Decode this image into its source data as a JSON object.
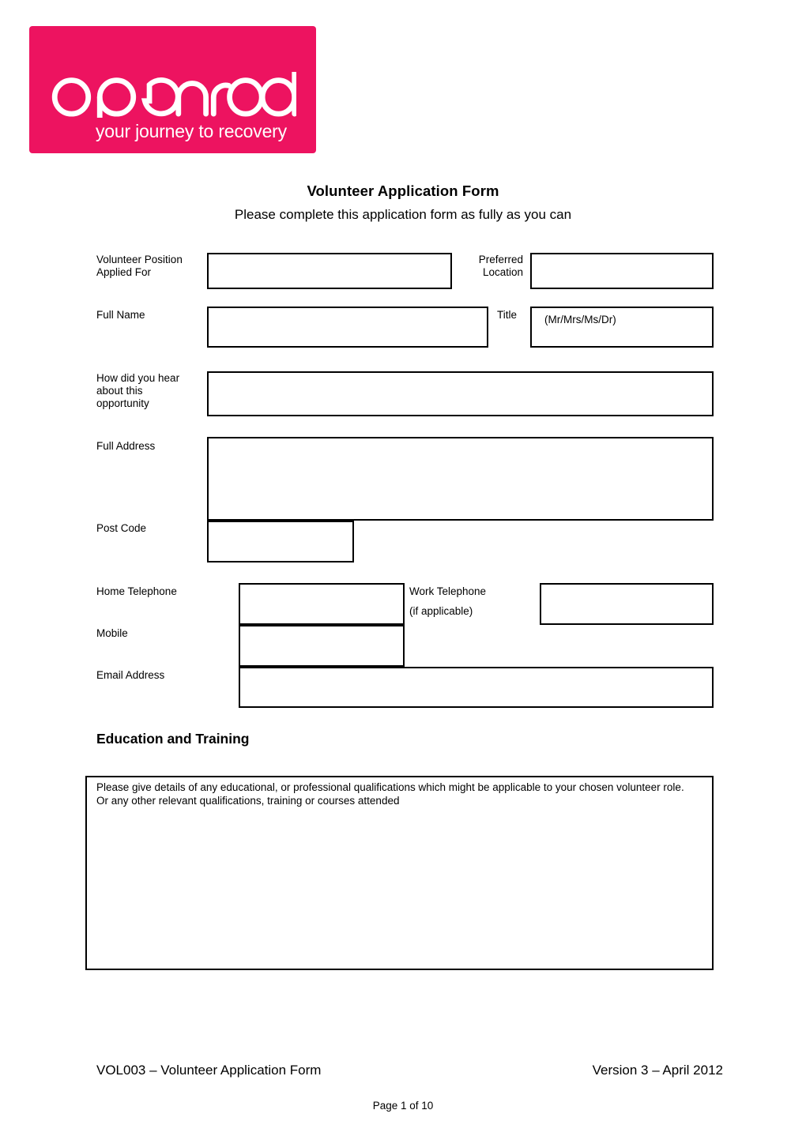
{
  "logo": {
    "wordmark": "openroad",
    "tagline": "your journey to recovery",
    "brand_color": "#ED1360"
  },
  "header": {
    "title": "Volunteer Application Form",
    "subtitle": "Please complete this application form as fully as you can"
  },
  "fields": {
    "volunteer_position": {
      "label": "Volunteer Position\nApplied For",
      "value": ""
    },
    "preferred_location": {
      "label": "Preferred\nLocation",
      "value": ""
    },
    "full_name": {
      "label": "Full Name",
      "value": ""
    },
    "title": {
      "label": "Title",
      "value": "",
      "hint": "(Mr/Mrs/Ms/Dr)"
    },
    "how_did_you_hear": {
      "label": "How did you hear\nabout this\nopportunity",
      "value": ""
    },
    "full_address": {
      "label": "Full Address",
      "value": ""
    },
    "post_code": {
      "label": "Post Code",
      "value": ""
    },
    "home_telephone": {
      "label": "Home Telephone",
      "value": ""
    },
    "work_telephone": {
      "label": "Work Telephone",
      "sublabel": "(if applicable)",
      "value": ""
    },
    "mobile": {
      "label": "Mobile",
      "value": ""
    },
    "email_address": {
      "label": "Email Address",
      "value": ""
    }
  },
  "education": {
    "heading": "Education and Training",
    "instructions_line1": "Please give details of any educational, or professional qualifications which might  be applicable to your chosen volunteer role.",
    "instructions_line2": "Or any other relevant qualifications, training or courses attended",
    "value": ""
  },
  "footer": {
    "left": "VOL003 – Volunteer Application Form",
    "right": "Version 3 – April 2012",
    "page": "Page 1 of 10"
  }
}
